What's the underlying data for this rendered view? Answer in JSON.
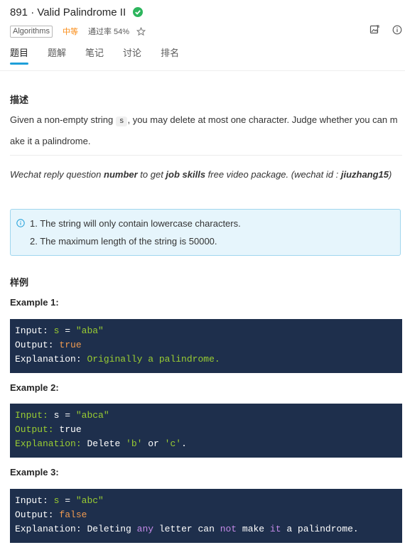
{
  "problem": {
    "title": "891 · Valid Palindrome II",
    "tag": "Algorithms",
    "difficulty": "中等",
    "pass_rate": "通过率 54%"
  },
  "tabs": [
    "题目",
    "题解",
    "笔记",
    "讨论",
    "排名"
  ],
  "description": {
    "heading": "描述",
    "text_before": "Given a non-empty string ",
    "code": "s",
    "text_after": ", you may delete at most one character. Judge whether you can make it a palindrome."
  },
  "wechat": {
    "p1": "Wechat reply question ",
    "b1": "number",
    "p2": " to get ",
    "b2": "job skills",
    "p3": " free video package. (wechat id : ",
    "b3": "jiuzhang15",
    "p4": ")"
  },
  "notes": [
    "1. The string will only contain lowercase characters.",
    "2. The maximum length of the string is 50000."
  ],
  "examples_heading": "样例",
  "examples": [
    {
      "title": "Example 1:",
      "input_label": "Input:",
      "input_var": "s",
      "input_eq": " = ",
      "input_val": "\"aba\"",
      "output_label": "Output:",
      "output_val": "true",
      "expl_label": "Explanation:",
      "expl_text": "Originally a palindrome."
    },
    {
      "title": "Example 2:",
      "input_label": "Input:",
      "input_var": "s",
      "input_eq": " = ",
      "input_val": "\"abca\"",
      "output_label": "Output:",
      "output_val": "true",
      "expl_label": "Explanation:",
      "expl_a": "Delete ",
      "expl_b": "'b'",
      "expl_c": " or ",
      "expl_d": "'c'",
      "expl_e": "."
    },
    {
      "title": "Example 3:",
      "input_label": "Input:",
      "input_var": "s",
      "input_eq": " = ",
      "input_val": "\"abc\"",
      "output_label": "Output:",
      "output_val": "false",
      "expl_label": "Explanation:",
      "expl_a": "Deleting ",
      "expl_b": "any",
      "expl_c": " letter can ",
      "expl_d": "not",
      "expl_e": " make ",
      "expl_f": "it",
      "expl_g": " a palindrome."
    }
  ]
}
